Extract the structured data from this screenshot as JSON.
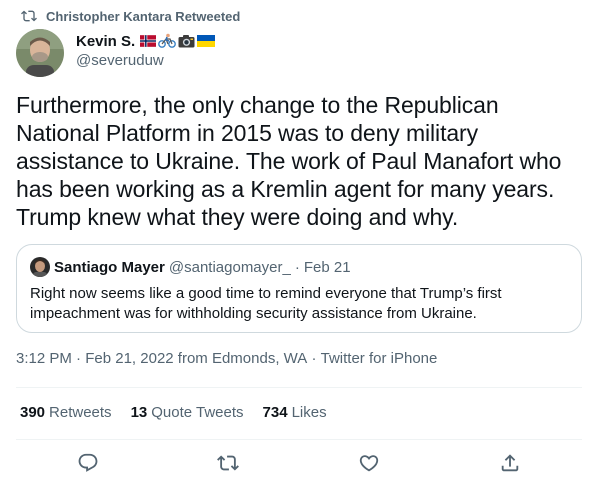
{
  "retweet_banner": {
    "text": "Christopher Kantara Retweeted"
  },
  "author": {
    "name": "Kevin S.",
    "handle": "@severuduw",
    "badges": [
      "norway-flag",
      "cyclist",
      "camera",
      "ukraine-flag"
    ]
  },
  "tweet": {
    "text": "Furthermore, the only change to the Republican National Platform in 2015 was to deny military assistance to Ukraine. The work of Paul Manafort who has been working as a Kremlin agent for many years. Trump knew what they were doing and why."
  },
  "quoted_tweet": {
    "name": "Santiago Mayer",
    "handle": "@santiagomayer_",
    "separator": "·",
    "date": "Feb 21",
    "text": "Right now seems like a good time to remind everyone that Trump’s first impeachment was for withholding security assistance from Ukraine."
  },
  "meta": {
    "time": "3:12 PM",
    "sep": " · ",
    "date": "Feb 21, 2022",
    "location": " from Edmonds, WA",
    "source": "Twitter for iPhone"
  },
  "stats": {
    "retweets": {
      "count": "390",
      "label": "Retweets"
    },
    "quotes": {
      "count": "13",
      "label": "Quote Tweets"
    },
    "likes": {
      "count": "734",
      "label": "Likes"
    }
  },
  "colors": {
    "text_primary": "#0f1419",
    "text_secondary": "#536471",
    "border": "#cfd9de",
    "divider": "#eff3f4"
  },
  "icons": {
    "retweet_banner": "retweet-icon",
    "reply": "reply-icon",
    "retweet": "retweet-icon",
    "like": "heart-icon",
    "share": "share-icon"
  }
}
